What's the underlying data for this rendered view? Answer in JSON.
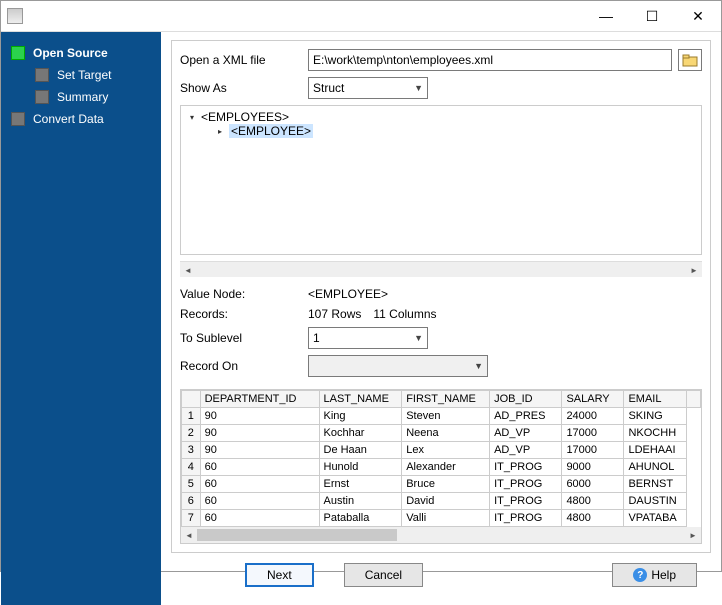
{
  "titlebar": {
    "min": "—",
    "max": "☐",
    "close": "✕"
  },
  "sidebar": {
    "items": [
      {
        "label": "Open Source",
        "active": true,
        "sub": false
      },
      {
        "label": "Set Target",
        "active": false,
        "sub": true
      },
      {
        "label": "Summary",
        "active": false,
        "sub": true
      },
      {
        "label": "Convert Data",
        "active": false,
        "sub": false
      }
    ]
  },
  "fields": {
    "open_label": "Open a XML file",
    "file_path": "E:\\work\\temp\\nton\\employees.xml",
    "show_as_label": "Show As",
    "show_as_value": "Struct",
    "value_node_label": "Value Node:",
    "value_node_value": "<EMPLOYEE>",
    "records_label": "Records:",
    "records_rows": "107 Rows",
    "records_cols": "11 Columns",
    "tosublabel": "To Sublevel",
    "tosubvalue": "1",
    "recordon_label": "Record On",
    "recordon_value": ""
  },
  "tree": {
    "root": "<EMPLOYEES>",
    "child": "<EMPLOYEE>"
  },
  "grid": {
    "columns": [
      "DEPARTMENT_ID",
      "LAST_NAME",
      "FIRST_NAME",
      "JOB_ID",
      "SALARY",
      "EMAIL"
    ],
    "rows": [
      {
        "n": "1",
        "c": [
          "90",
          "King",
          "Steven",
          "AD_PRES",
          "24000",
          "SKING"
        ]
      },
      {
        "n": "2",
        "c": [
          "90",
          "Kochhar",
          "Neena",
          "AD_VP",
          "17000",
          "NKOCHH"
        ]
      },
      {
        "n": "3",
        "c": [
          "90",
          "De Haan",
          "Lex",
          "AD_VP",
          "17000",
          "LDEHAAI"
        ]
      },
      {
        "n": "4",
        "c": [
          "60",
          "Hunold",
          "Alexander",
          "IT_PROG",
          "9000",
          "AHUNOL"
        ]
      },
      {
        "n": "5",
        "c": [
          "60",
          "Ernst",
          "Bruce",
          "IT_PROG",
          "6000",
          "BERNST"
        ]
      },
      {
        "n": "6",
        "c": [
          "60",
          "Austin",
          "David",
          "IT_PROG",
          "4800",
          "DAUSTIN"
        ]
      },
      {
        "n": "7",
        "c": [
          "60",
          "Pataballa",
          "Valli",
          "IT_PROG",
          "4800",
          "VPATABA"
        ]
      }
    ]
  },
  "buttons": {
    "next": "Next",
    "cancel": "Cancel",
    "help": "Help"
  }
}
